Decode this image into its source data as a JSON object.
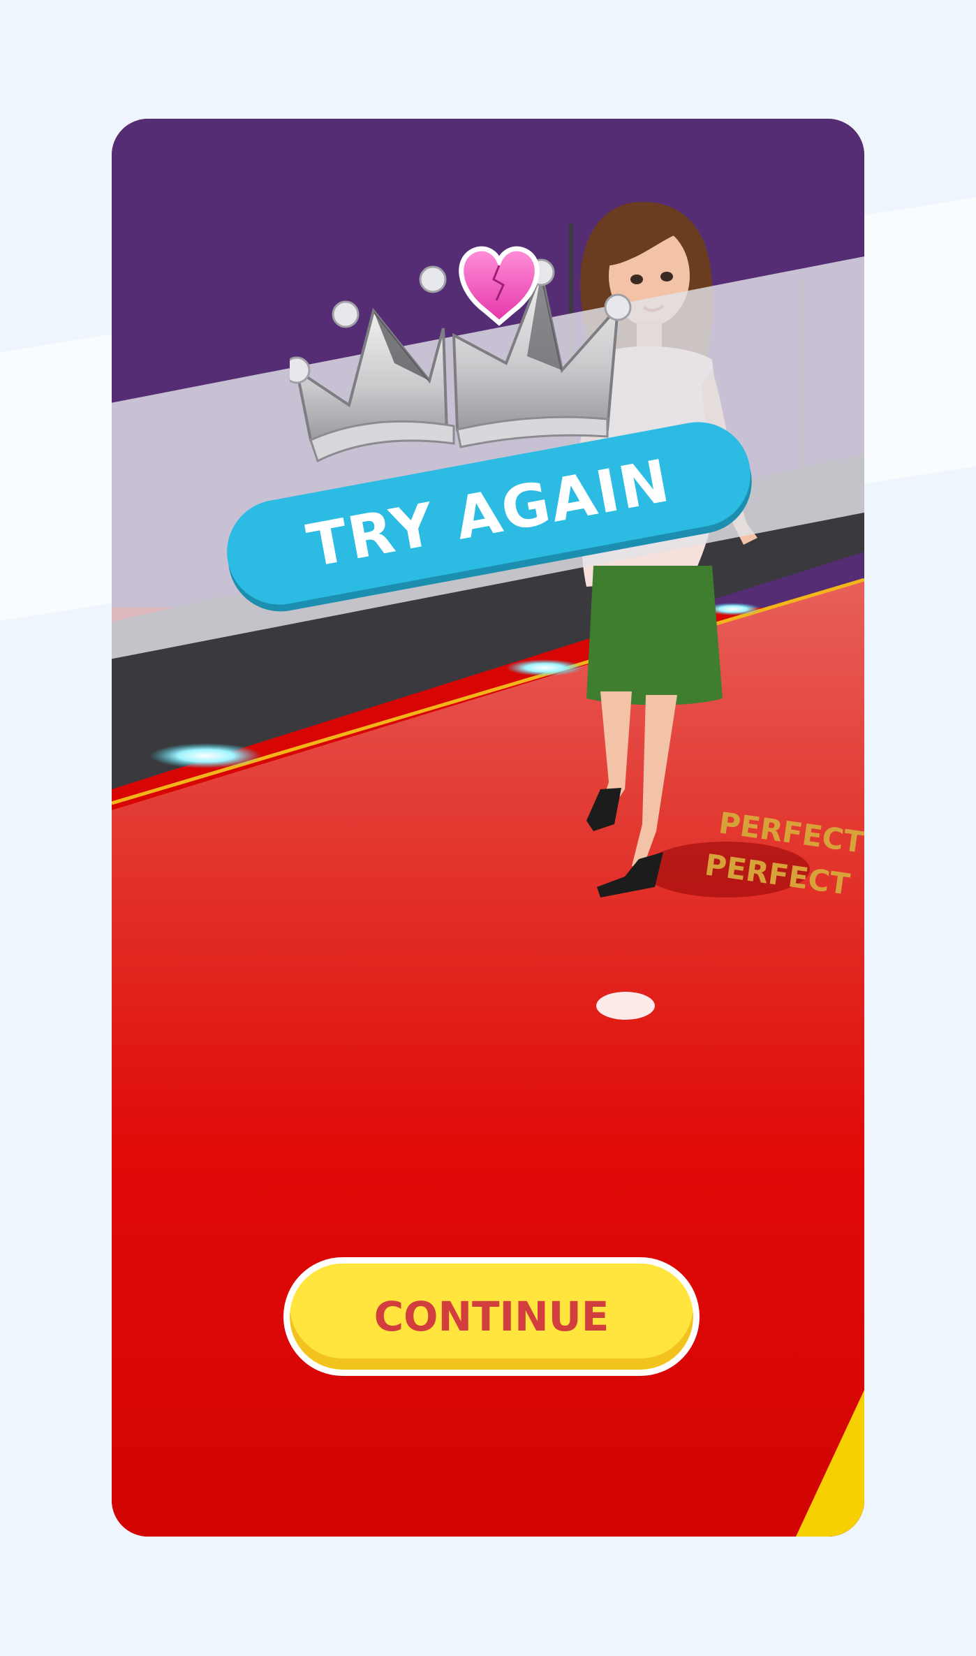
{
  "result": {
    "banner_text": "TRY AGAIN",
    "continue_label": "CONTINUE",
    "floor_text": "PERFECT"
  },
  "colors": {
    "banner": "#2bbbe3",
    "continue_fill": "#ffe53d",
    "continue_text": "#d23d3d",
    "carpet": "#d80505",
    "backdrop": "#542d74"
  },
  "icons": {
    "crown": "silver-crown-icon",
    "heart": "cracked-heart-icon"
  }
}
